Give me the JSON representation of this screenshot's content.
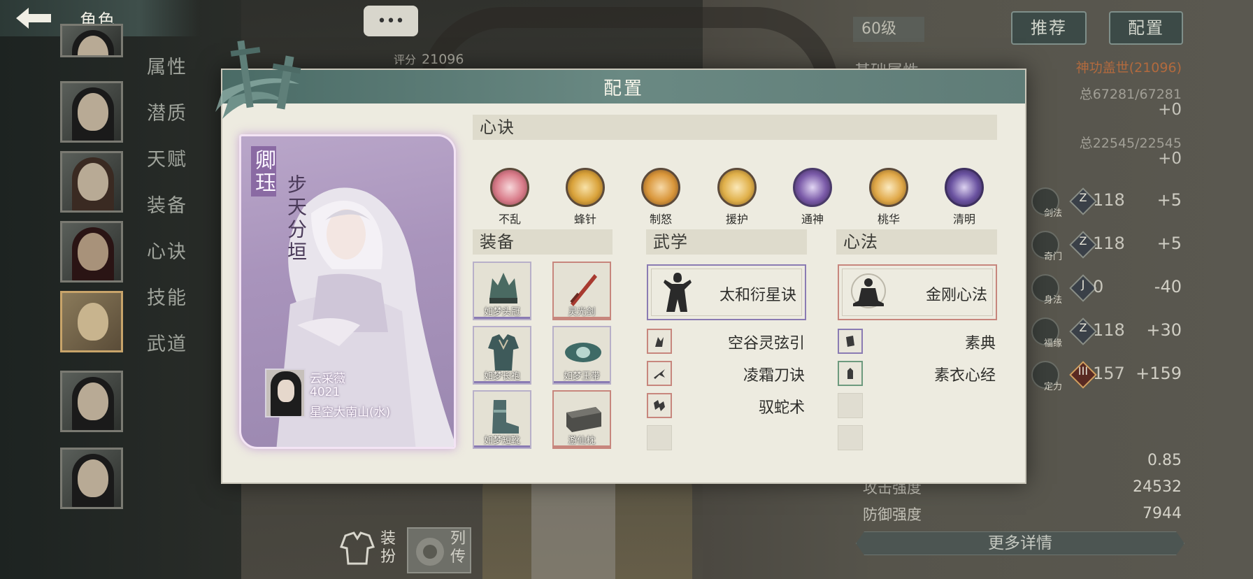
{
  "header": {
    "title": "角色"
  },
  "side_menu": [
    "属性",
    "潜质",
    "天赋",
    "装备",
    "心诀",
    "技能",
    "武道"
  ],
  "chat": {
    "label": "•••"
  },
  "score": {
    "label": "评分",
    "value": "21096"
  },
  "level": "60级",
  "top_buttons": {
    "recommend": "推荐",
    "config": "配置"
  },
  "stats_panel": {
    "title": "基础属性",
    "divine": "神功盖世(21096)",
    "total1": "总67281/67281",
    "plus1": "+0",
    "total2": "总22545/22545",
    "plus2": "+0",
    "rows": [
      {
        "skill": "剑法",
        "tier": "Z",
        "value": "118",
        "delta": "+5"
      },
      {
        "skill": "奇门",
        "tier": "Z",
        "value": "118",
        "delta": "+5"
      },
      {
        "skill": "身法",
        "tier": "J",
        "value": "0",
        "delta": "-40"
      },
      {
        "skill": "福缘",
        "tier": "Z",
        "value": "118",
        "delta": "+30"
      },
      {
        "skill": "定力",
        "tier": "III",
        "value": "157",
        "delta": "+159"
      }
    ],
    "extra_value": "0.85",
    "attack_label": "攻击强度",
    "attack_value": "24532",
    "defense_label": "防御强度",
    "defense_value": "7944",
    "more_details": "更多详情"
  },
  "bottom_buttons": {
    "dress": "装扮",
    "bio": "列传"
  },
  "modal": {
    "title": "配置",
    "character": {
      "name": "卿珏",
      "title": "步天分垣",
      "owner_name": "云采薇",
      "owner_id": "4021",
      "owner_server": "星空大南山(水)"
    },
    "xinjue_header": "心诀",
    "xinjue": [
      {
        "label": "不乱",
        "color": "#d97c8a"
      },
      {
        "label": "蜂针",
        "color": "#d9a23a"
      },
      {
        "label": "制怒",
        "color": "#d9963a"
      },
      {
        "label": "援护",
        "color": "#e0b04a"
      },
      {
        "label": "通神",
        "color": "#7a5aa8"
      },
      {
        "label": "桃华",
        "color": "#e0a848"
      },
      {
        "label": "清明",
        "color": "#6a52a0"
      }
    ],
    "equip_header": "装备",
    "equipment": [
      {
        "name": "如梦头冠",
        "border": "purple"
      },
      {
        "name": "灵光剑",
        "border": "red"
      },
      {
        "name": "如梦长袍",
        "border": "purple"
      },
      {
        "name": "如梦玉带",
        "border": "purple"
      },
      {
        "name": "如梦短靴",
        "border": "purple"
      },
      {
        "name": "游仙枕",
        "border": "red"
      }
    ],
    "wuxue_header": "武学",
    "wuxue_main": "太和衍星诀",
    "wuxue_sub": [
      "空谷灵弦引",
      "凌霜刀诀",
      "驭蛇术"
    ],
    "xinfa_header": "心法",
    "xinfa_main": "金刚心法",
    "xinfa_sub": [
      "素典",
      "素衣心经"
    ]
  }
}
